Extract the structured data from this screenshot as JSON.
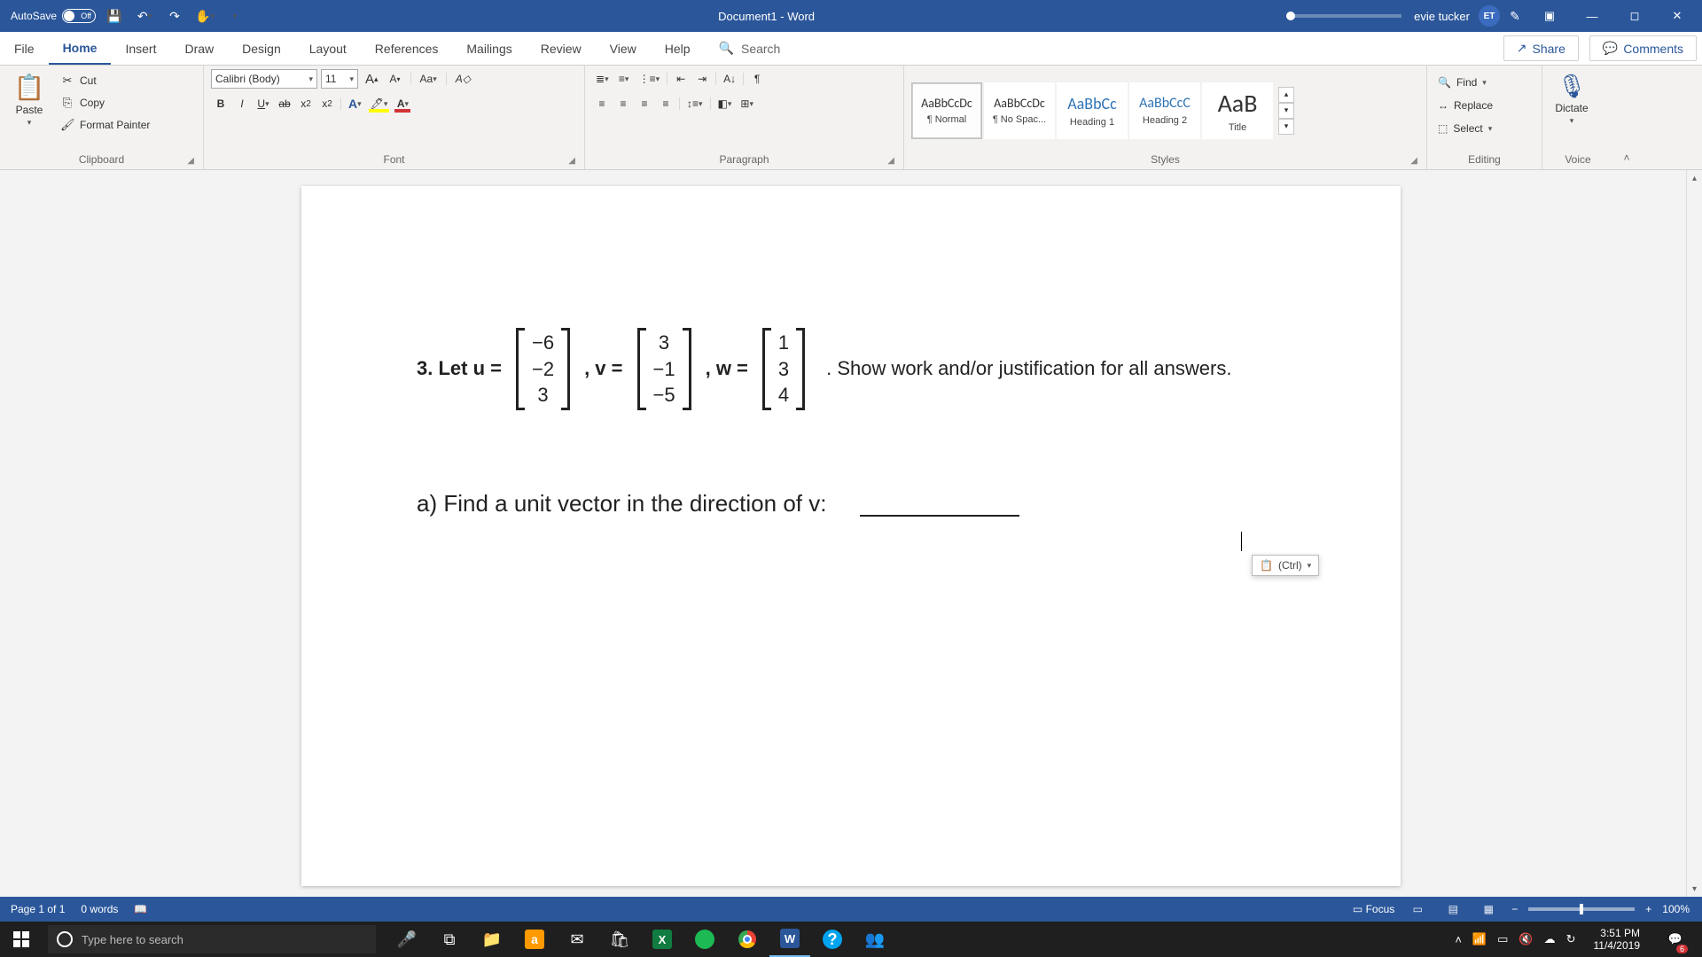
{
  "titlebar": {
    "autosave_label": "AutoSave",
    "autosave_state": "Off",
    "doc_title": "Document1  -  Word",
    "user_name": "evie tucker",
    "user_initials": "ET"
  },
  "tabs": {
    "items": [
      "File",
      "Home",
      "Insert",
      "Draw",
      "Design",
      "Layout",
      "References",
      "Mailings",
      "Review",
      "View",
      "Help"
    ],
    "active": "Home",
    "search_placeholder": "Search",
    "share": "Share",
    "comments": "Comments"
  },
  "ribbon": {
    "clipboard": {
      "paste": "Paste",
      "cut": "Cut",
      "copy": "Copy",
      "format_painter": "Format Painter",
      "label": "Clipboard"
    },
    "font": {
      "name": "Calibri (Body)",
      "size": "11",
      "label": "Font"
    },
    "paragraph": {
      "label": "Paragraph"
    },
    "styles": {
      "label": "Styles",
      "items": [
        {
          "sample": "AaBbCcDc",
          "name": "¶ Normal",
          "size": "14px",
          "selected": true
        },
        {
          "sample": "AaBbCcDc",
          "name": "¶ No Spac...",
          "size": "14px"
        },
        {
          "sample": "AaBbCc",
          "name": "Heading 1",
          "size": "18px",
          "color": "#2e74b5"
        },
        {
          "sample": "AaBbCcC",
          "name": "Heading 2",
          "size": "16px",
          "color": "#2e74b5"
        },
        {
          "sample": "AaB",
          "name": "Title",
          "size": "28px"
        }
      ]
    },
    "editing": {
      "find": "Find",
      "replace": "Replace",
      "select": "Select",
      "label": "Editing"
    },
    "voice": {
      "dictate": "Dictate",
      "label": "Voice"
    }
  },
  "document": {
    "problem_prefix": "3. Let ",
    "u_label": "u =",
    "u": [
      "−6",
      "−2",
      "3"
    ],
    "v_label": ", v =",
    "v": [
      "3",
      "−1",
      "−5"
    ],
    "w_label": ", w =",
    "w": [
      "1",
      "3",
      "4"
    ],
    "problem_suffix": ".  Show work and/or justification for all answers.",
    "part_a": "a) Find a unit vector in the direction of v:",
    "paste_options": "(Ctrl) "
  },
  "statusbar": {
    "page": "Page 1 of 1",
    "words": "0 words",
    "focus": "Focus",
    "zoom": "100%"
  },
  "taskbar": {
    "search_placeholder": "Type here to search",
    "time": "3:51 PM",
    "date": "11/4/2019",
    "notif_count": "6"
  }
}
